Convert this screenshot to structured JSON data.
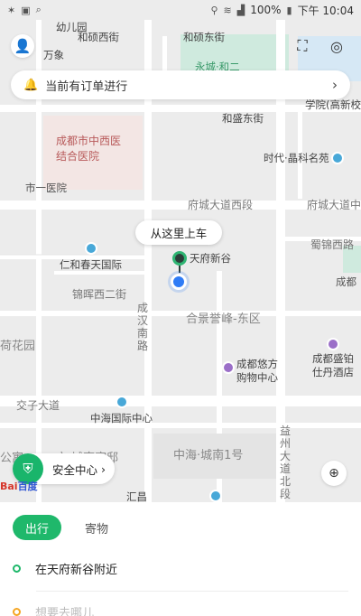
{
  "status_bar": {
    "left_icons": [
      "sparkle-icon",
      "bag-icon",
      "search-icon"
    ],
    "battery": "100%",
    "time": "下午 10:04"
  },
  "order_banner": {
    "text": "当前有订单进行"
  },
  "map": {
    "pickup_label": "从这里上车",
    "pickup_place": "天府新谷",
    "labels": {
      "kindergarten": "幼儿园",
      "hepo_west": "和硕西街",
      "hepo_east": "和硕东街",
      "wanxiang": "万象",
      "mall": "永城·和二",
      "hengrui": "和盛东街",
      "xuehe": "学院(高新校",
      "tcm_hospital": "成都市中西医\n结合医院",
      "no1_hospital": "市一医院",
      "jingke": "时代·晶科名苑",
      "fucheng_west": "府城大道西段",
      "fucheng_road": "府城大道中",
      "shujin": "蜀锦西路",
      "chengdu_small": "成都",
      "renhe": "仁和春天国际",
      "jinhui": "锦晖西二街",
      "chenghan": "成汉南路",
      "hejing": "合景誉峰-东区",
      "huayuan": "荷花园",
      "yuefang": "成都悠方\n购物中心",
      "shengbo": "成都盛铂\n仕丹酒店",
      "jiaozi": "交子大道",
      "zhonghai_intl": "中海国际中心",
      "zhonghai_city": "中海·城南1号",
      "yizhou": "益州大道北段",
      "chengda": "市·城南官邸",
      "gongyu": "公寓",
      "huichang": "汇昌"
    }
  },
  "safety_center": {
    "label": "安全中心"
  },
  "baidu_logo": "Bai百度",
  "panel": {
    "tabs": [
      {
        "label": "出行",
        "active": true
      },
      {
        "label": "寄物",
        "active": false
      }
    ],
    "origin": "在天府新谷附近",
    "destination": "想要去哪儿"
  }
}
